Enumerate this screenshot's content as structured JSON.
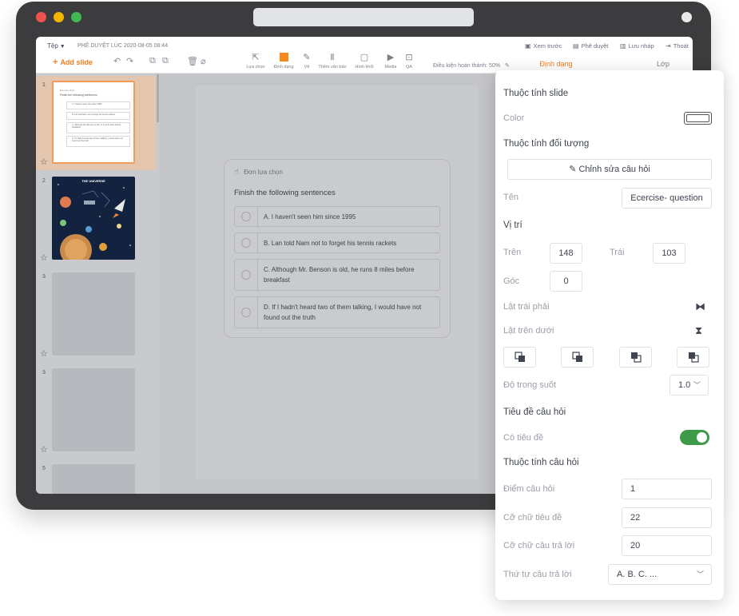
{
  "toolbar": {
    "file_menu": "Tệp",
    "save_status": "PHÊ DUYỆT LÚC 2020-08-05  08:44",
    "add_slide": "Add slide",
    "tools": [
      {
        "label": "Lựa chọn",
        "icon": "select-cursor-icon"
      },
      {
        "label": "Định dạng",
        "icon": "format-color-icon"
      },
      {
        "label": "Vẽ",
        "icon": "pencil-icon"
      },
      {
        "label": "Thêm văn bản",
        "icon": "text-icon"
      },
      {
        "label": "Hình khối",
        "icon": "shapes-icon"
      },
      {
        "label": "Media",
        "icon": "media-icon"
      },
      {
        "label": "QA",
        "icon": "qa-icon"
      }
    ],
    "completion": "Điều kiện hoàn thành: 50%",
    "preview": "Xem trước",
    "approve": "Phê duyệt",
    "save_draft": "Lưu nháp",
    "exit": "Thoát",
    "tab_format": "Định dạng",
    "tab_layer": "Lớp"
  },
  "slides": [
    {
      "number": "1"
    },
    {
      "number": "2",
      "title": "THE UNIVERSE"
    },
    {
      "number": "3"
    },
    {
      "number": "3"
    },
    {
      "number": "5"
    }
  ],
  "question": {
    "type_label": "Đơn lựa chọn",
    "title": "Finish the following sentences",
    "options": [
      "A. I haven't seen him since 1995",
      "B. Lan told Nam not to forget his tennis rackets",
      "C. Although Mr. Benson is old, he runs 8 miles before breakfast",
      "D. If I hadn't heard two of them talking, I would have not found out the truth"
    ]
  },
  "panel": {
    "slide_props": "Thuộc tính slide",
    "color_label": "Color",
    "object_props": "Thuộc tính đối tượng",
    "edit_question": "Chỉnh sửa câu hỏi",
    "name_label": "Tên",
    "name_value": "Ecercise- question",
    "position_heading": "Vị trí",
    "top_label": "Trên",
    "top_value": "148",
    "left_label": "Trái",
    "left_value": "103",
    "angle_label": "Góc",
    "angle_value": "0",
    "flip_h_label": "Lật trái phải",
    "flip_v_label": "Lật trên dưới",
    "opacity_label": "Độ trong suốt",
    "opacity_value": "1.0",
    "question_title_heading": "Tiêu đề câu hỏi",
    "has_title_label": "Có tiêu đề",
    "has_title_on": true,
    "question_props_heading": "Thuộc tính câu hỏi",
    "score_label": "Điểm câu hỏi",
    "score_value": "1",
    "title_size_label": "Cỡ chữ tiêu đề",
    "title_size_value": "22",
    "answer_size_label": "Cỡ chữ câu trả lời",
    "answer_size_value": "20",
    "answer_order_label": "Thứ tự câu trả lời",
    "answer_order_value": "A. B. C. ..."
  },
  "colors": {
    "accent": "#f07c1e",
    "toggle_on": "#3c9a48"
  }
}
